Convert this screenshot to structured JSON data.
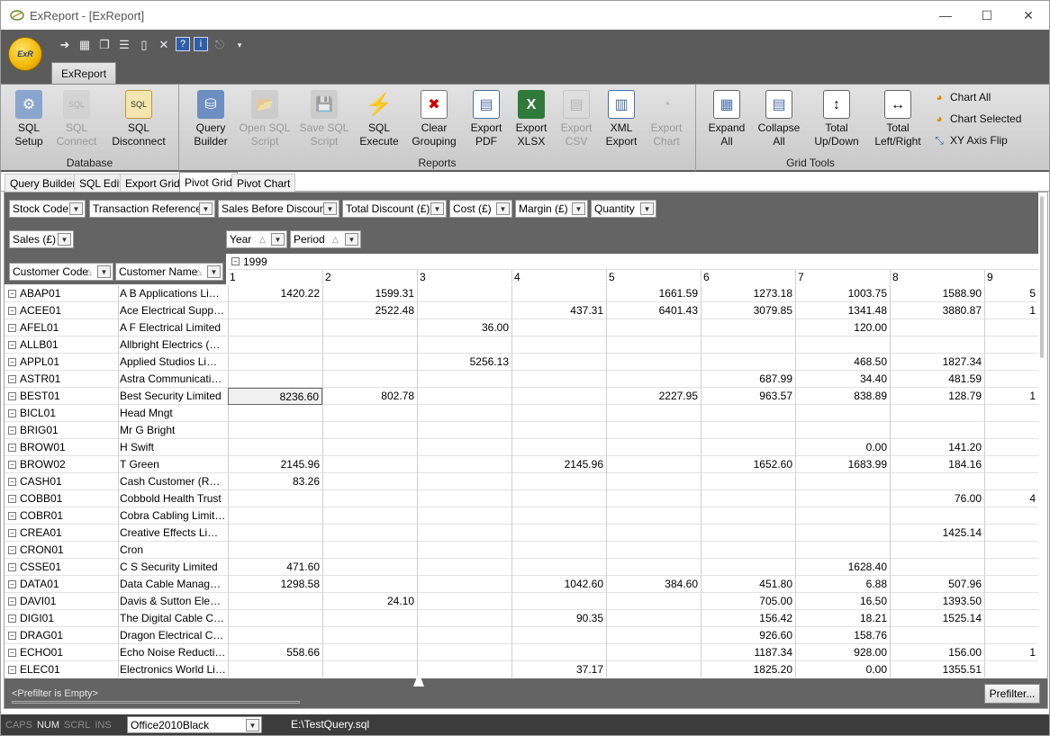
{
  "window": {
    "title": "ExReport - [ExReport]",
    "minimize": "—",
    "maximize": "☐",
    "close": "✕"
  },
  "orb": {
    "label": "ExR"
  },
  "ribbon": {
    "tab": "ExReport",
    "groups": {
      "database": {
        "title": "Database",
        "buttons": [
          {
            "label": "SQL\nSetup",
            "l1": "SQL",
            "l2": "Setup",
            "enabled": true,
            "icon": "sql-setup-icon"
          },
          {
            "l1": "SQL",
            "l2": "Connect",
            "enabled": false,
            "icon": "sql-connect-icon"
          },
          {
            "l1": "SQL",
            "l2": "Disconnect",
            "enabled": true,
            "icon": "sql-disconnect-icon"
          }
        ]
      },
      "reports": {
        "title": "Reports",
        "buttons": [
          {
            "l1": "Query",
            "l2": "Builder",
            "enabled": true
          },
          {
            "l1": "Open SQL",
            "l2": "Script",
            "enabled": false
          },
          {
            "l1": "Save SQL",
            "l2": "Script",
            "enabled": false
          },
          {
            "l1": "SQL",
            "l2": "Execute",
            "enabled": true
          },
          {
            "l1": "Clear",
            "l2": "Grouping",
            "enabled": true
          },
          {
            "l1": "Export",
            "l2": "PDF",
            "enabled": true
          },
          {
            "l1": "Export",
            "l2": "XLSX",
            "enabled": true
          },
          {
            "l1": "Export",
            "l2": "CSV",
            "enabled": false
          },
          {
            "l1": "XML",
            "l2": "Export",
            "enabled": true
          },
          {
            "l1": "Export",
            "l2": "Chart",
            "enabled": false
          }
        ]
      },
      "gridtools": {
        "title": "Grid Tools",
        "buttons": [
          {
            "l1": "Expand",
            "l2": "All"
          },
          {
            "l1": "Collapse",
            "l2": "All"
          },
          {
            "l1": "Total",
            "l2": "Up/Down"
          },
          {
            "l1": "Total",
            "l2": "Left/Right"
          }
        ],
        "small": [
          "Chart All",
          "Chart Selected",
          "XY Axis Flip"
        ]
      }
    }
  },
  "tabs": [
    "Query Builder",
    "SQL Edit",
    "Export Grid",
    "Pivot Grid",
    "Pivot Chart"
  ],
  "active_tab": "Pivot Grid",
  "filter_fields": [
    "Stock Code",
    "Transaction Reference",
    "Sales Before Discount",
    "Total Discount (£)",
    "Cost (£)",
    "Margin (£)",
    "Quantity"
  ],
  "data_field": "Sales (£)",
  "column_fields": [
    "Year",
    "Period"
  ],
  "row_fields": [
    "Customer Code",
    "Customer Name"
  ],
  "year": "1999",
  "periods": [
    "1",
    "2",
    "3",
    "4",
    "5",
    "6",
    "7",
    "8",
    "9"
  ],
  "rows": [
    {
      "code": "ABAP01",
      "name": "A B Applications Limited",
      "v": [
        "1420.22",
        "1599.31",
        "",
        "",
        "1661.59",
        "1273.18",
        "1003.75",
        "1588.90",
        "5"
      ]
    },
    {
      "code": "ACEE01",
      "name": "Ace Electrical Supplies",
      "v": [
        "",
        "2522.48",
        "",
        "437.31",
        "6401.43",
        "3079.85",
        "1341.48",
        "3880.87",
        "1"
      ]
    },
    {
      "code": "AFEL01",
      "name": "A F Electrical Limited",
      "v": [
        "",
        "",
        "36.00",
        "",
        "",
        "",
        "120.00",
        "",
        ""
      ]
    },
    {
      "code": "ALLB01",
      "name": "Allbright Electrics (Paris)",
      "v": [
        "",
        "",
        "",
        "",
        "",
        "",
        "",
        "",
        ""
      ]
    },
    {
      "code": "APPL01",
      "name": "Applied Studios Limited",
      "v": [
        "",
        "",
        "5256.13",
        "",
        "",
        "",
        "468.50",
        "1827.34",
        ""
      ]
    },
    {
      "code": "ASTR01",
      "name": "Astra Communication...",
      "v": [
        "",
        "",
        "",
        "",
        "",
        "687.99",
        "34.40",
        "481.59",
        ""
      ]
    },
    {
      "code": "BEST01",
      "name": "Best Security Limited",
      "v": [
        "8236.60",
        "802.78",
        "",
        "",
        "2227.95",
        "963.57",
        "838.89",
        "128.79",
        "1"
      ]
    },
    {
      "code": "BICL01",
      "name": "Head Mngt",
      "v": [
        "",
        "",
        "",
        "",
        "",
        "",
        "",
        "",
        ""
      ]
    },
    {
      "code": "BRIG01",
      "name": "Mr G Bright",
      "v": [
        "",
        "",
        "",
        "",
        "",
        "",
        "",
        "",
        ""
      ]
    },
    {
      "code": "BROW01",
      "name": "H Swift",
      "v": [
        "",
        "",
        "",
        "",
        "",
        "",
        "0.00",
        "141.20",
        ""
      ]
    },
    {
      "code": "BROW02",
      "name": "T Green",
      "v": [
        "2145.96",
        "",
        "",
        "2145.96",
        "",
        "1652.60",
        "1683.99",
        "184.16",
        ""
      ]
    },
    {
      "code": "CASH01",
      "name": "Cash Customer (Retai...",
      "v": [
        "83.26",
        "",
        "",
        "",
        "",
        "",
        "",
        "",
        ""
      ]
    },
    {
      "code": "COBB01",
      "name": "Cobbold Health Trust",
      "v": [
        "",
        "",
        "",
        "",
        "",
        "",
        "",
        "76.00",
        "4"
      ]
    },
    {
      "code": "COBR01",
      "name": "Cobra Cabling Limited",
      "v": [
        "",
        "",
        "",
        "",
        "",
        "",
        "",
        "",
        ""
      ]
    },
    {
      "code": "CREA01",
      "name": "Creative Effects Limited",
      "v": [
        "",
        "",
        "",
        "",
        "",
        "",
        "",
        "1425.14",
        ""
      ]
    },
    {
      "code": "CRON01",
      "name": "Cron",
      "v": [
        "",
        "",
        "",
        "",
        "",
        "",
        "",
        "",
        ""
      ]
    },
    {
      "code": "CSSE01",
      "name": "C S Security Limited",
      "v": [
        "471.60",
        "",
        "",
        "",
        "",
        "",
        "1628.40",
        "",
        ""
      ]
    },
    {
      "code": "DATA01",
      "name": "Data Cable Managem...",
      "v": [
        "1298.58",
        "",
        "",
        "1042.60",
        "384.60",
        "451.80",
        "6.88",
        "507.96",
        ""
      ]
    },
    {
      "code": "DAVI01",
      "name": "Davis & Sutton Electri...",
      "v": [
        "",
        "24.10",
        "",
        "",
        "",
        "705.00",
        "16.50",
        "1393.50",
        ""
      ]
    },
    {
      "code": "DIGI01",
      "name": "The Digital Cable Com...",
      "v": [
        "",
        "",
        "",
        "90.35",
        "",
        "156.42",
        "18.21",
        "1525.14",
        ""
      ]
    },
    {
      "code": "DRAG01",
      "name": "Dragon Electrical Con...",
      "v": [
        "",
        "",
        "",
        "",
        "",
        "926.60",
        "158.76",
        "",
        ""
      ]
    },
    {
      "code": "ECHO01",
      "name": "Echo Noise Reduction...",
      "v": [
        "558.66",
        "",
        "",
        "",
        "",
        "1187.34",
        "928.00",
        "156.00",
        "1"
      ]
    },
    {
      "code": "ELEC01",
      "name": "Electronics World Limi...",
      "v": [
        "",
        "",
        "",
        "37.17",
        "",
        "1825.20",
        "0.00",
        "1355.51",
        ""
      ]
    }
  ],
  "selected_cell": {
    "row": 6,
    "col": 0
  },
  "prefilter": {
    "text": "<Prefilter is Empty>",
    "button": "Prefilter..."
  },
  "status": {
    "caps": "CAPS",
    "num": "NUM",
    "scrl": "SCRL",
    "ins": "INS",
    "skin": "Office2010Black",
    "path": "E:\\TestQuery.sql"
  }
}
